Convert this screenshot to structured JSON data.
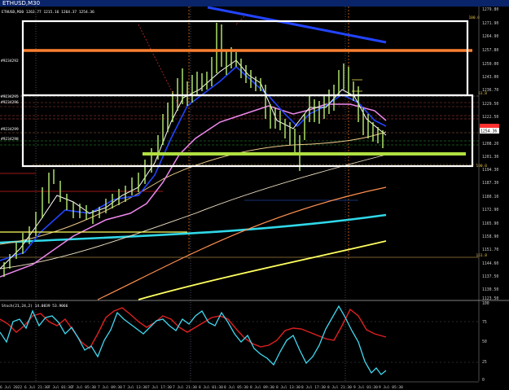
{
  "window": {
    "title": "ETHUSD,M30"
  },
  "chart": {
    "symbol_info": "ETHUSD,M30  1263.77 1215.16 1264.37 1254.36",
    "price_axis": [
      "1279.80",
      "1271.90",
      "1264.90",
      "1257.80",
      "1250.00",
      "1243.00",
      "1236.70",
      "1229.50",
      "1222.50",
      "1215.50",
      "1208.20",
      "1201.30",
      "1194.30",
      "1187.30",
      "1180.10",
      "1172.90",
      "1165.90",
      "1158.90",
      "1151.70",
      "1144.60",
      "1137.50",
      "1130.50",
      "1123.50"
    ],
    "current_price": "1254.36",
    "fib_levels": [
      {
        "label": "100.0",
        "value": "1271.90"
      },
      {
        "label": "61.8",
        "value": "1229.50"
      },
      {
        "label": "100.0",
        "value": "1194.30"
      },
      {
        "label": "161.8",
        "value": "1144.60"
      }
    ],
    "left_labels": [
      "#9234292",
      "#9234295",
      "#9234296",
      "#9234299",
      "#9234298"
    ],
    "colors": {
      "candles": "#b8f070",
      "ma_fast": "#ffffff",
      "ma_blue": "#2244ff",
      "ma_pink": "#ee88ee",
      "ma_beige": "#f5e6c8",
      "ma_tan": "#e8c88a",
      "ma_orange_thin": "#ff9050",
      "ma_cyan": "#30d8e8",
      "ma_yellow": "#ffff60",
      "ma_salmon": "#ff8866",
      "trendline": "#2244ff",
      "hline_orange": "#ff8030",
      "hline_lime": "#b0e040",
      "box": "#ffffff"
    }
  },
  "indicator": {
    "label": "Stoch(21,24,2) 14.0839 53.9066",
    "axis": [
      "100",
      "75",
      "50",
      "25",
      "0"
    ],
    "main_color": "#40d8f0",
    "signal_color": "#e02020"
  },
  "time_axis": [
    "6 Jul 2022",
    "6 Jul 21:30",
    "7 Jul 01:30",
    "7 Jul 05:30",
    "7 Jul 09:30",
    "7 Jul 13:30",
    "7 Jul 17:30",
    "7 Jul 21:30",
    "8 Jul 01:30",
    "8 Jul 05:30",
    "8 Jul 09:30",
    "8 Jul 13:30",
    "8 Jul 17:30",
    "8 Jul 21:30",
    "9 Jul 01:30",
    "9 Jul 05:30"
  ]
}
